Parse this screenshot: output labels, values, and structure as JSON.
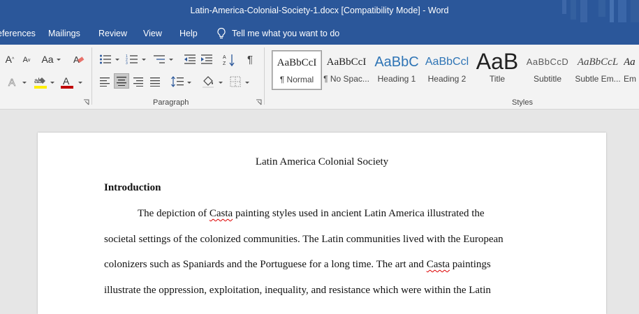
{
  "window": {
    "title": "Latin-America-Colonial-Society-1.docx [Compatibility Mode]  -  Word"
  },
  "tabs": [
    "eferences",
    "Mailings",
    "Review",
    "View",
    "Help"
  ],
  "tell_me": {
    "placeholder": "Tell me what you want to do",
    "icon": "lightbulb-icon"
  },
  "ribbon": {
    "font_group": {
      "grow_label": "A",
      "shrink_label": "A",
      "case_label": "Aa"
    },
    "paragraph_label": "Paragraph",
    "styles_label": "Styles",
    "styles": [
      {
        "sample": "AaBbCcI",
        "name": "¶ Normal",
        "selected": true
      },
      {
        "sample": "AaBbCcI",
        "name": "¶ No Spac...",
        "selected": false
      },
      {
        "sample": "AaBbC",
        "name": "Heading 1",
        "selected": false
      },
      {
        "sample": "AaBbCcl",
        "name": "Heading 2",
        "selected": false
      },
      {
        "sample": "AaB",
        "name": "Title",
        "selected": false
      },
      {
        "sample": "AaBbCcD",
        "name": "Subtitle",
        "selected": false
      },
      {
        "sample": "AaBbCcL",
        "name": "Subtle Em...",
        "selected": false
      },
      {
        "sample": "Aa",
        "name": "Em",
        "selected": false
      }
    ]
  },
  "document": {
    "title": "Latin America Colonial Society",
    "heading": "Introduction",
    "lines": [
      {
        "segments": [
          {
            "text": "The depiction of ",
            "spell": false
          },
          {
            "text": "Casta",
            "spell": true
          },
          {
            "text": " painting styles used in ancient Latin America illustrated the",
            "spell": false
          }
        ]
      },
      {
        "segments": [
          {
            "text": "societal settings of the colonized communities. The Latin communities lived with the European",
            "spell": false
          }
        ]
      },
      {
        "segments": [
          {
            "text": "colonizers such as Spaniards and the Portuguese for a long time. The art and ",
            "spell": false
          },
          {
            "text": "Casta",
            "spell": true
          },
          {
            "text": " paintings",
            "spell": false
          }
        ]
      },
      {
        "segments": [
          {
            "text": "illustrate the oppression, exploitation, inequality, and resistance which were within the Latin",
            "spell": false
          }
        ]
      }
    ]
  }
}
